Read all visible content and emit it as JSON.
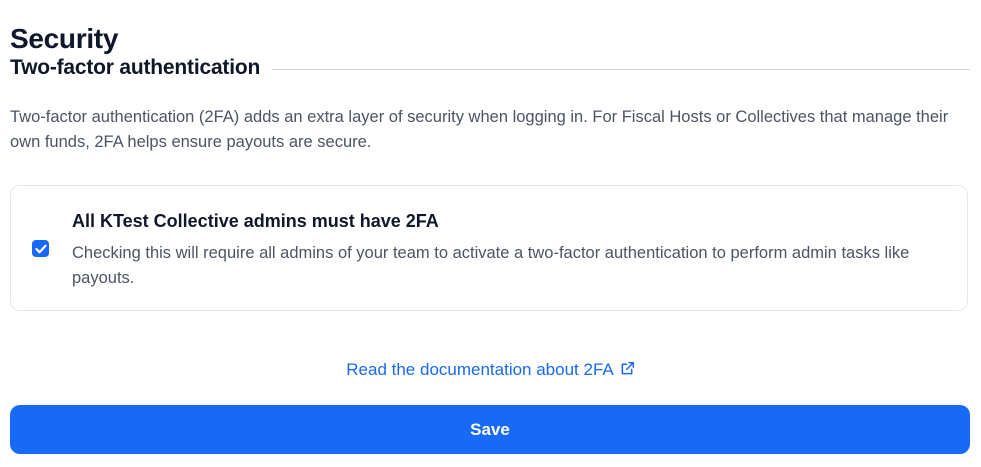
{
  "page": {
    "title": "Security"
  },
  "two_factor": {
    "section_title": "Two-factor authentication",
    "description": "Two-factor authentication (2FA) adds an extra layer of security when logging in. For Fiscal Hosts or Collectives that manage their own funds, 2FA helps ensure payouts are secure.",
    "requirement": {
      "checked": true,
      "label": "All KTest Collective admins must have 2FA",
      "description": "Checking this will require all admins of your team to activate a two-factor authentication to perform admin tasks like payouts."
    },
    "doc_link": {
      "label": "Read the documentation about 2FA",
      "icon": "external-link-icon"
    }
  },
  "actions": {
    "save_label": "Save"
  },
  "colors": {
    "accent": "#1869f5",
    "text": "#0f172a",
    "muted_text": "#4b5563",
    "border": "#e2e8f0"
  }
}
